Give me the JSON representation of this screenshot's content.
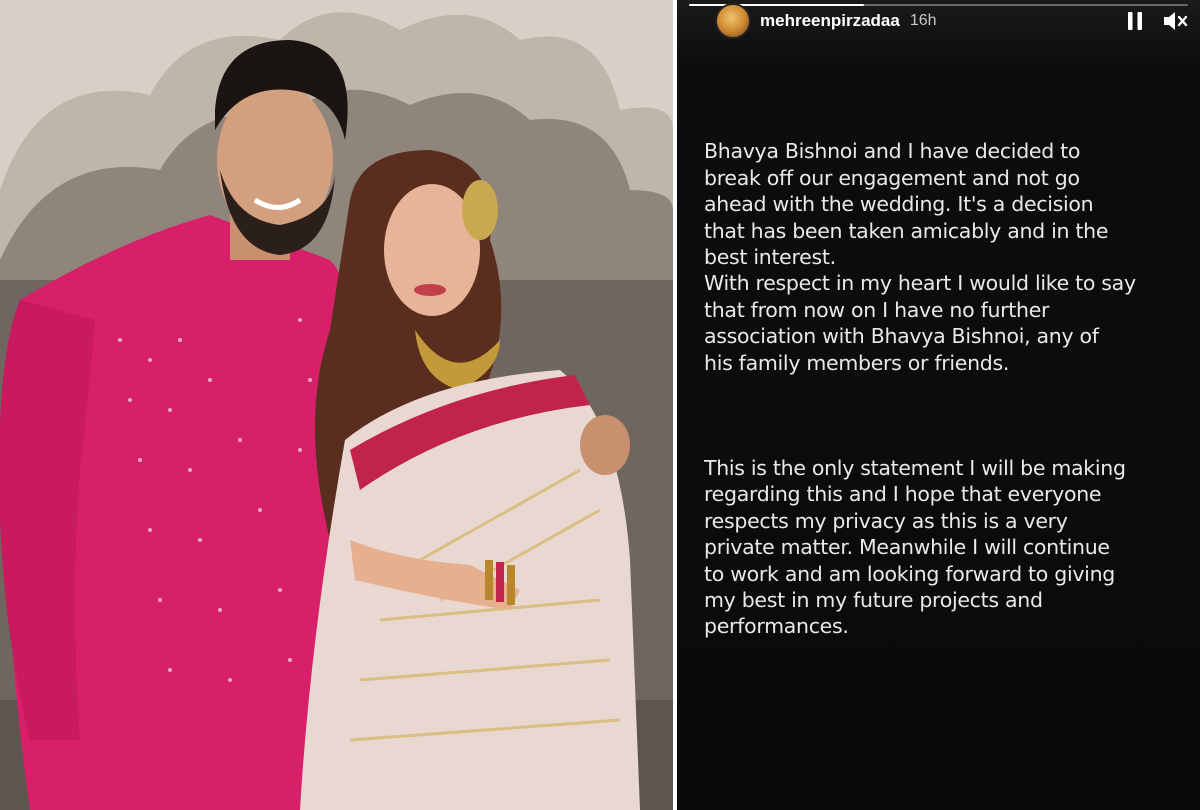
{
  "story": {
    "username": "mehreenpirzadaa",
    "time_ago": "16h",
    "progress": 0.35,
    "controls": {
      "pause_icon": "pause-icon",
      "mute_icon": "muted-speaker-icon"
    },
    "paragraph_1": "Bhavya Bishnoi and I have decided to\nbreak off our engagement and not go\nahead with the wedding. It's a decision\nthat has been taken amicably and in the\nbest interest.\nWith respect in my heart I would like to say\nthat from now on I have no further\nassociation with Bhavya Bishnoi, any of\nhis family members or friends.",
    "paragraph_2": "This is the only statement I will be making\nregarding this and I hope that everyone\nrespects my privacy as this is a very\nprivate matter.  Meanwhile I will continue\nto work and am looking forward to giving\nmy best in my future projects and\nperformances."
  },
  "colors": {
    "kurta": "#d8206a",
    "saree_border": "#c2234a",
    "story_bg": "#0a0a0a",
    "wall": "#cfc7bd"
  }
}
